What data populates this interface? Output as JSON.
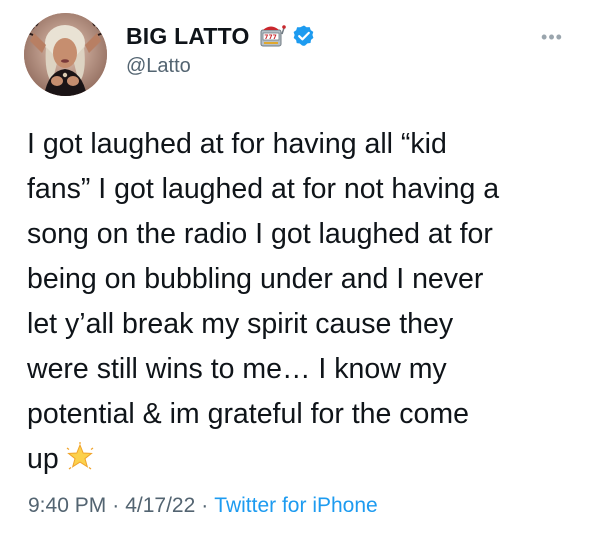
{
  "author": {
    "display_name": "BIG LATTO",
    "handle": "@Latto",
    "name_emoji": "slot-machine-icon",
    "verified": true
  },
  "more_button": {
    "label": "•••"
  },
  "tweet": {
    "text": "I got laughed at for having all “kid\nfans” I got laughed at for not having a\nsong on the radio I got laughed at for\nbeing on bubbling under and I never\nlet y’all break my spirit cause they\nwere still wins to me… I know my\npotential & im grateful for the come\nup",
    "trailing_emoji": "glowing-star-icon",
    "time": "9:40 PM",
    "date": "4/17/22",
    "separator": "·",
    "source": "Twitter for iPhone"
  },
  "colors": {
    "text": "#0f1419",
    "secondary": "#536471",
    "link": "#1d9bf0",
    "verified": "#1d9bf0"
  }
}
